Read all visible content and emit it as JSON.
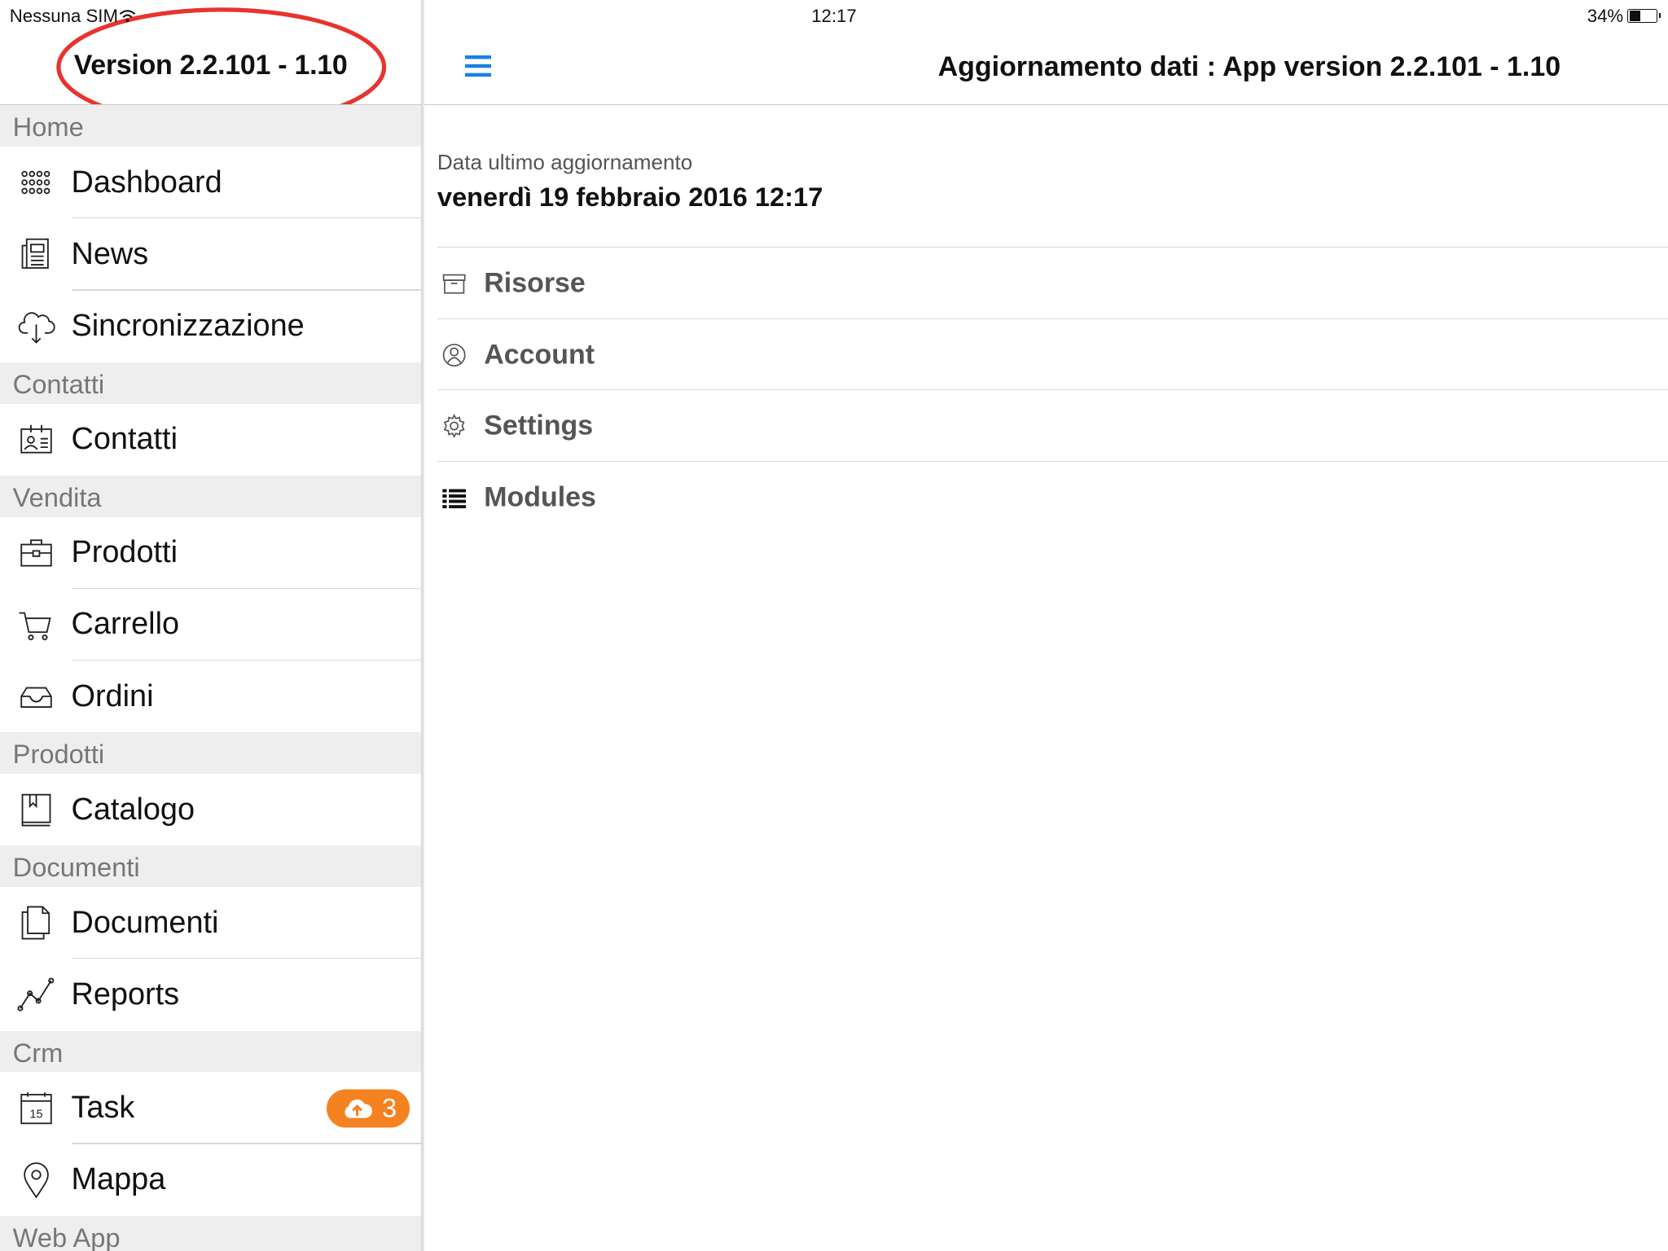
{
  "status_bar": {
    "carrier": "Nessuna SIM",
    "time": "12:17",
    "battery": "34%"
  },
  "sidebar": {
    "version_label": "Version 2.2.101 - 1.10",
    "sections": [
      {
        "header": "Home",
        "items": [
          {
            "label": "Dashboard",
            "icon": "grid-dots-icon"
          },
          {
            "label": "News",
            "icon": "newspaper-icon"
          },
          {
            "label": "Sincronizzazione",
            "icon": "cloud-download-icon"
          }
        ]
      },
      {
        "header": "Contatti",
        "items": [
          {
            "label": "Contatti",
            "icon": "contact-card-icon"
          }
        ]
      },
      {
        "header": "Vendita",
        "items": [
          {
            "label": "Prodotti",
            "icon": "briefcase-icon"
          },
          {
            "label": "Carrello",
            "icon": "cart-icon"
          },
          {
            "label": "Ordini",
            "icon": "inbox-tray-icon"
          }
        ]
      },
      {
        "header": "Prodotti",
        "items": [
          {
            "label": "Catalogo",
            "icon": "book-icon"
          }
        ]
      },
      {
        "header": "Documenti",
        "items": [
          {
            "label": "Documenti",
            "icon": "documents-icon"
          },
          {
            "label": "Reports",
            "icon": "line-chart-icon"
          }
        ]
      },
      {
        "header": "Crm",
        "items": [
          {
            "label": "Task",
            "icon": "calendar-icon",
            "calendar_day": "15",
            "badge": "3",
            "badge_icon": "cloud-upload-icon",
            "badge_color": "#F58220"
          },
          {
            "label": "Mappa",
            "icon": "map-pin-icon"
          }
        ]
      },
      {
        "header": "Web App",
        "items": []
      }
    ]
  },
  "nav": {
    "title": "Aggiornamento dati : App version 2.2.101 - 1.10",
    "menu_icon": "hamburger-icon",
    "accent_color": "#1A7FE6"
  },
  "content": {
    "last_update_label": "Data ultimo aggiornamento",
    "last_update_value": "venerdì 19 febbraio 2016 12:17",
    "options": [
      {
        "label": "Risorse",
        "icon": "archive-box-icon"
      },
      {
        "label": "Account",
        "icon": "user-circle-icon"
      },
      {
        "label": "Settings",
        "icon": "gear-icon"
      },
      {
        "label": "Modules",
        "icon": "list-icon"
      }
    ]
  },
  "annotation": {
    "shape": "ellipse",
    "color": "#E8332E"
  }
}
